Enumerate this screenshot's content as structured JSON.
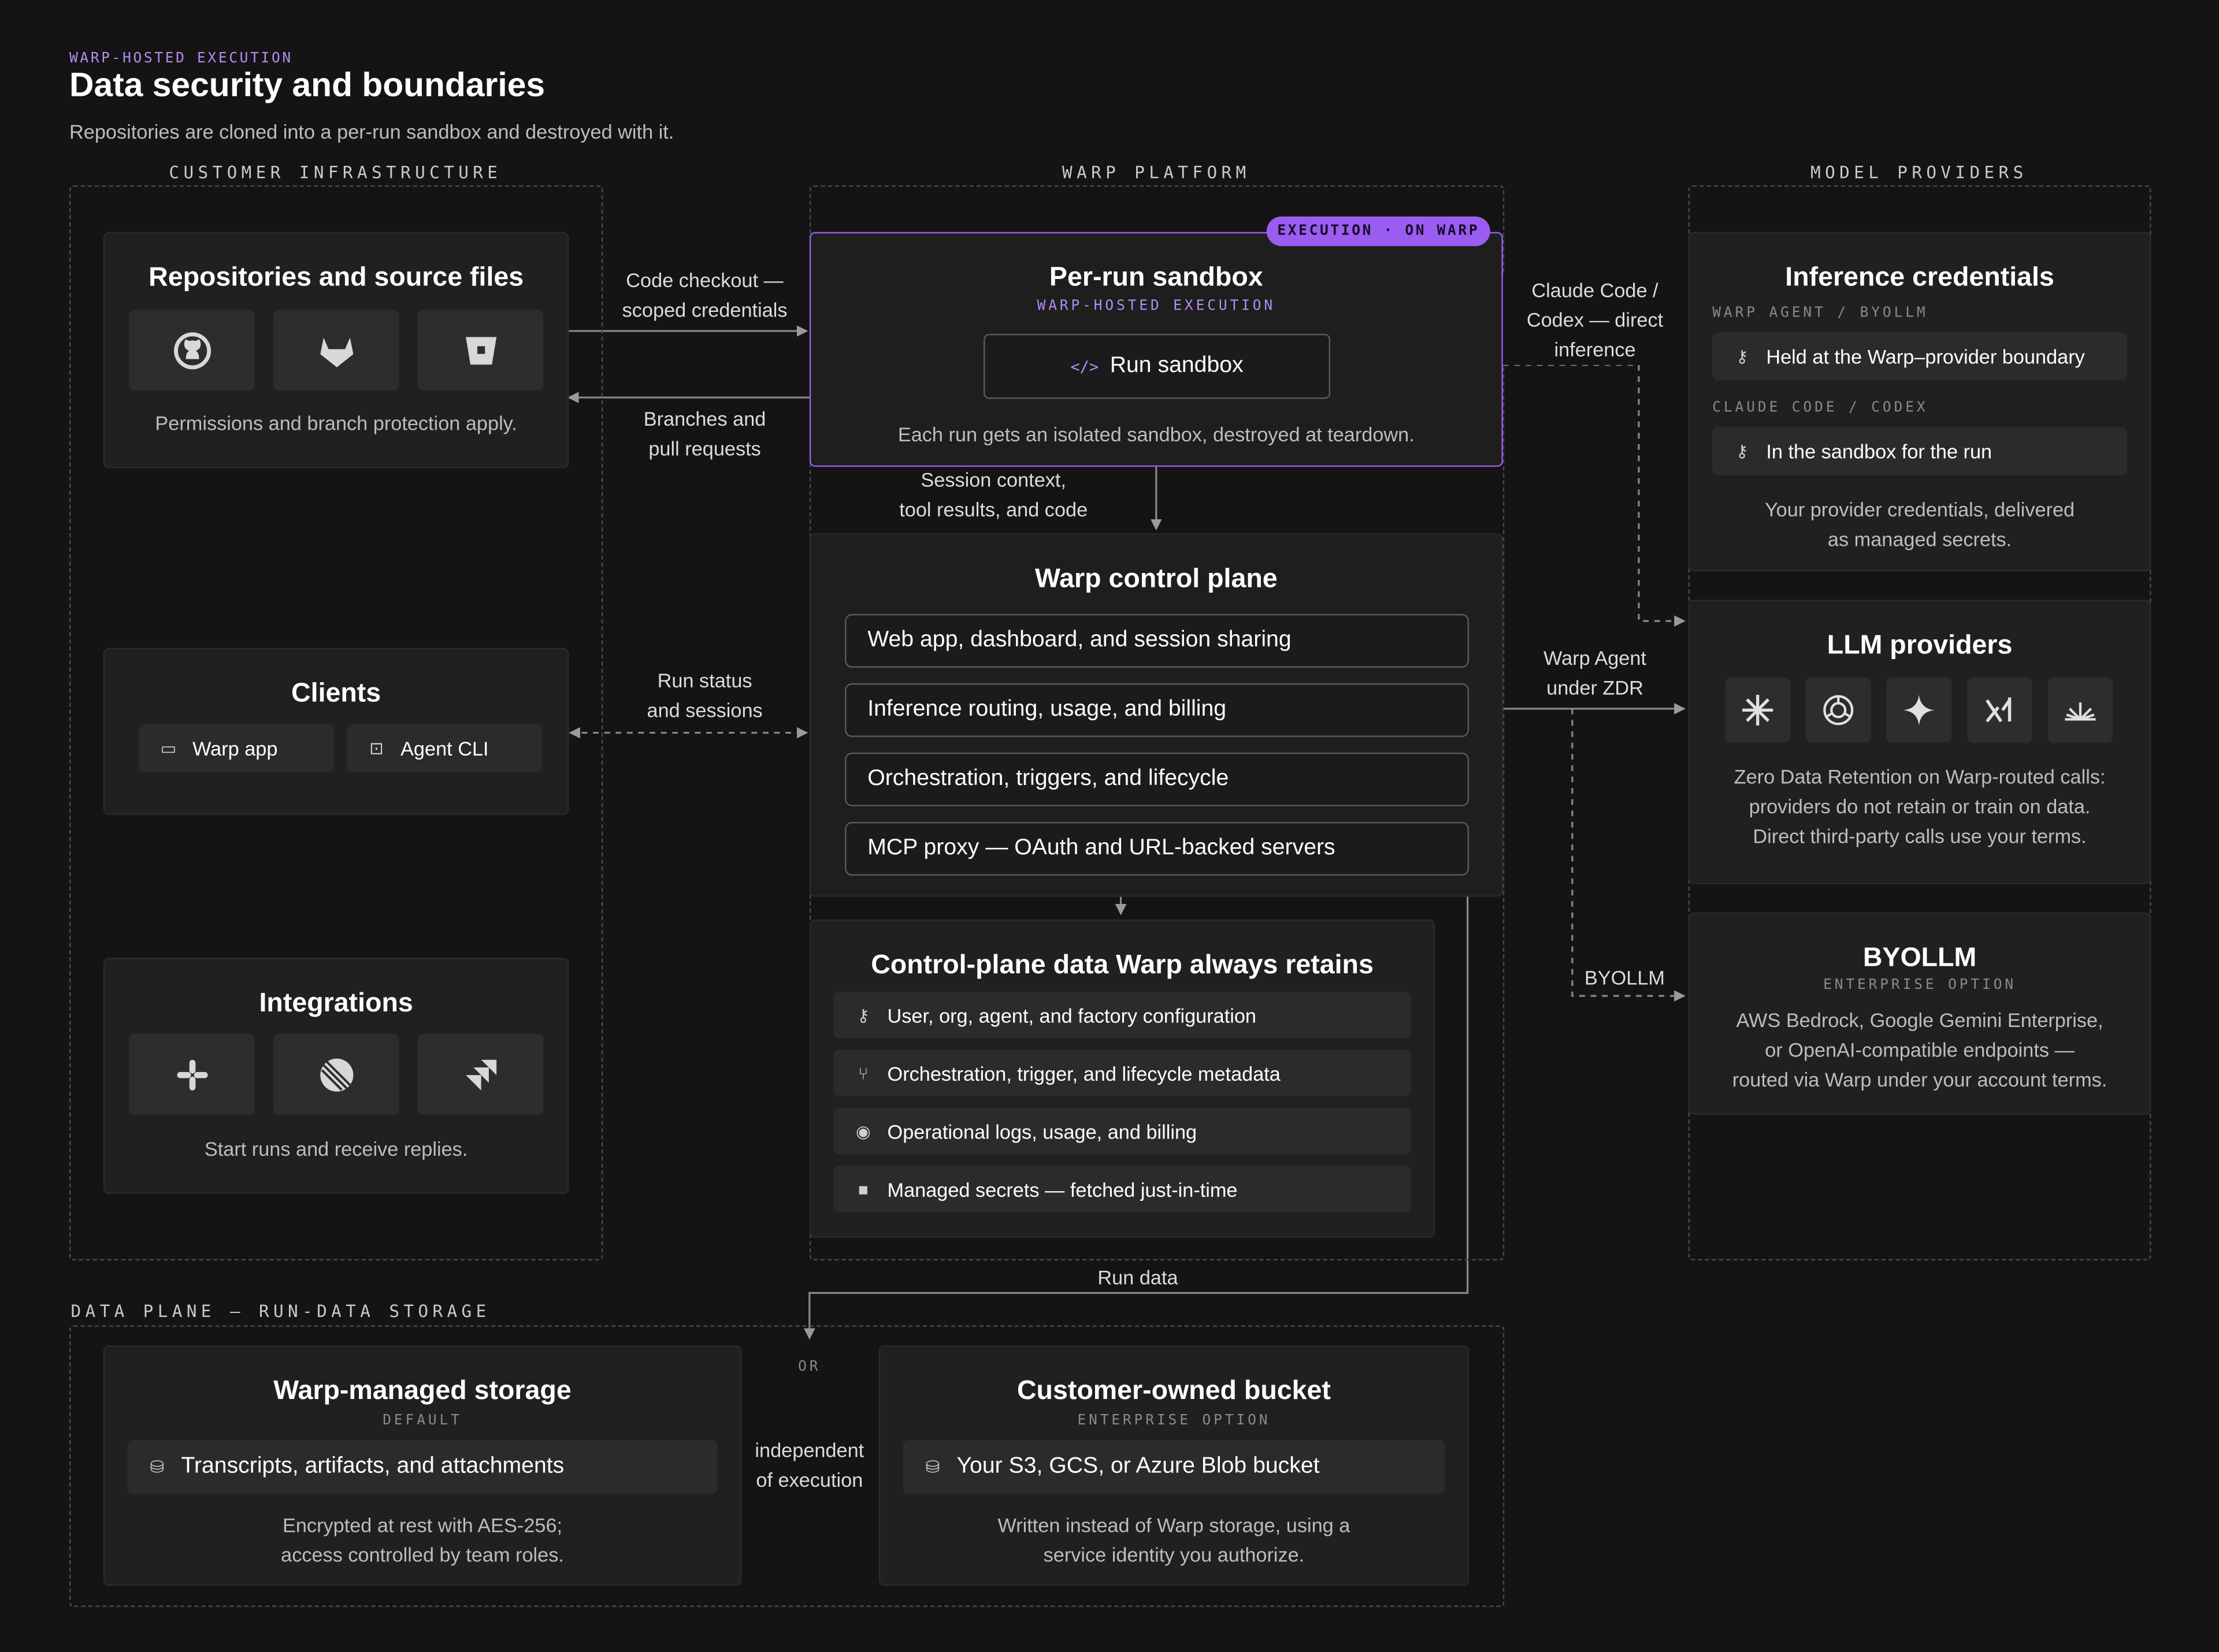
{
  "header": {
    "eyebrow": "WARP-HOSTED EXECUTION",
    "title": "Data security and boundaries",
    "subtitle": "Repositories are cloned into a per-run sandbox and destroyed with it."
  },
  "columns": {
    "customer": "CUSTOMER INFRASTRUCTURE",
    "warp": "WARP PLATFORM",
    "providers": "MODEL PROVIDERS",
    "data_plane": "DATA PLANE — RUN-DATA STORAGE"
  },
  "repos": {
    "title": "Repositories and source files",
    "icons": [
      "github-icon",
      "gitlab-icon",
      "bitbucket-icon"
    ],
    "note": "Permissions and branch protection apply."
  },
  "clients": {
    "title": "Clients",
    "items": [
      {
        "icon": "laptop-icon",
        "label": "Warp app"
      },
      {
        "icon": "terminal-icon",
        "label": "Agent CLI"
      }
    ]
  },
  "integrations": {
    "title": "Integrations",
    "icons": [
      "slack-icon",
      "linear-icon",
      "jira-icon"
    ],
    "note": "Start runs and receive replies."
  },
  "sandbox": {
    "badge": "EXECUTION · ON WARP",
    "title": "Per-run sandbox",
    "tag": "WARP-HOSTED EXECUTION",
    "button_icon": "</>",
    "button_label": "Run sandbox",
    "note": "Each run gets an isolated sandbox, destroyed at teardown."
  },
  "control_plane": {
    "title": "Warp control plane",
    "rows": [
      "Web app, dashboard, and session sharing",
      "Inference routing, usage, and billing",
      "Orchestration, triggers, and lifecycle",
      "MCP proxy — OAuth and URL-backed servers"
    ]
  },
  "retains": {
    "title": "Control-plane data Warp always retains",
    "items": [
      {
        "icon": "key-icon",
        "label": "User, org, agent, and factory configuration"
      },
      {
        "icon": "branch-icon",
        "label": "Orchestration, trigger, and lifecycle metadata"
      },
      {
        "icon": "eye-icon",
        "label": "Operational logs, usage, and billing"
      },
      {
        "icon": "lock-icon",
        "label": "Managed secrets — fetched just-in-time"
      }
    ]
  },
  "inference_credentials": {
    "title": "Inference credentials",
    "tag1": "WARP AGENT / BYOLLM",
    "row1": "Held at the Warp–provider boundary",
    "tag2": "CLAUDE CODE / CODEX",
    "row2": "In the sandbox for the run",
    "note_1": "Your provider credentials, delivered",
    "note_2": "as managed secrets."
  },
  "llm_providers": {
    "title": "LLM providers",
    "icons": [
      "anthropic-icon",
      "openai-icon",
      "gemini-icon",
      "xai-icon",
      "other-provider-icon"
    ],
    "note_1": "Zero Data Retention on Warp-routed calls:",
    "note_2": "providers do not retain or train on data.",
    "note_3": "Direct third-party calls use your terms."
  },
  "byollm": {
    "title": "BYOLLM",
    "tag": "ENTERPRISE OPTION",
    "note_1": "AWS Bedrock, Google Gemini Enterprise,",
    "note_2": "or OpenAI-compatible endpoints —",
    "note_3": "routed via Warp under your account terms."
  },
  "storage_warp": {
    "title": "Warp-managed storage",
    "tag": "DEFAULT",
    "row": "Transcripts, artifacts, and attachments",
    "note_1": "Encrypted at rest with AES-256;",
    "note_2": "access controlled by team roles."
  },
  "storage_customer": {
    "title": "Customer-owned bucket",
    "tag": "ENTERPRISE OPTION",
    "row": "Your S3, GCS, or Azure Blob bucket",
    "note_1": "Written instead of Warp storage, using a",
    "note_2": "service identity you authorize."
  },
  "edges": {
    "checkout_1": "Code checkout —",
    "checkout_2": "scoped credentials",
    "branches_1": "Branches and",
    "branches_2": "pull requests",
    "session_1": "Session context,",
    "session_2": "tool results, and code",
    "runstatus_1": "Run status",
    "runstatus_2": "and sessions",
    "claude_1": "Claude Code /",
    "claude_2": "Codex — direct",
    "claude_3": "inference",
    "zdr_1": "Warp Agent",
    "zdr_2": "under ZDR",
    "byollm": "BYOLLM",
    "run_data": "Run data",
    "or": "OR",
    "indep_1": "independent",
    "indep_2": "of execution"
  },
  "colors": {
    "background": "#141414",
    "card": "#202020",
    "accent": "#9b5cf0",
    "accent_text": "#b48cf2"
  }
}
